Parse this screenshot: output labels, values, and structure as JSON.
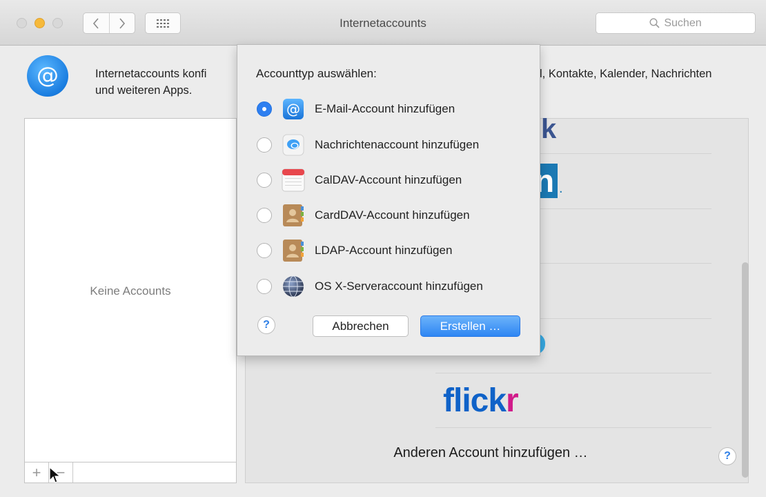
{
  "window": {
    "title": "Internetaccounts",
    "search_placeholder": "Suchen"
  },
  "header": {
    "line1_left": "Internetaccounts konfi",
    "line2_left": "und weiteren Apps.",
    "line1_right": "l, Kontakte, Kalender, Nachrichten"
  },
  "accounts": {
    "empty_message": "Keine Accounts",
    "add_label": "+",
    "remove_label": "−"
  },
  "providers": {
    "flickr_part1": "flick",
    "flickr_part2": "r",
    "other_account": "Anderen Account hinzufügen …",
    "help": "?",
    "facebook_partial": "k",
    "linkedin_partial": "n",
    "linkedin_dot": "."
  },
  "sheet": {
    "title": "Accounttyp auswählen:",
    "options": [
      {
        "label": "E-Mail-Account hinzufügen",
        "icon": "mail-at-icon",
        "selected": true
      },
      {
        "label": "Nachrichtenaccount hinzufügen",
        "icon": "messages-icon",
        "selected": false
      },
      {
        "label": "CalDAV-Account hinzufügen",
        "icon": "calendar-icon",
        "selected": false
      },
      {
        "label": "CardDAV-Account hinzufügen",
        "icon": "contacts-icon",
        "selected": false
      },
      {
        "label": "LDAP-Account hinzufügen",
        "icon": "contacts-icon",
        "selected": false
      },
      {
        "label": "OS X-Serveraccount hinzufügen",
        "icon": "globe-icon",
        "selected": false
      }
    ],
    "help": "?",
    "cancel_label": "Abbrechen",
    "create_label": "Erstellen …"
  },
  "colors": {
    "accent": "#2e7ff0",
    "flickr_blue": "#0f62c8",
    "flickr_pink": "#d11b8a"
  }
}
